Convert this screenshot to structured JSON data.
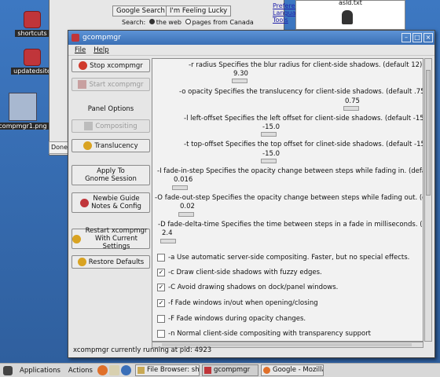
{
  "desktop": {
    "icons": [
      {
        "label": "shortcuts"
      },
      {
        "label": "updatedsite"
      },
      {
        "label": "compmgr1.png"
      }
    ]
  },
  "background_browser": {
    "search_button": "Google Search",
    "lucky_button": "I'm Feeling Lucky",
    "search_label": "Search:",
    "radio_web": "the web",
    "radio_canada": "pages from Canada",
    "link_preferences": "Preferences",
    "link_language": "Language Tools",
    "right_file": "asld.txt",
    "partial_button": "Done"
  },
  "window": {
    "title": "gcompmgr",
    "menu": {
      "file": "File",
      "help": "Help"
    },
    "sidebar": {
      "stop": "Stop xcompmgr",
      "start": "Start xcompmgr",
      "panel_options": "Panel Options",
      "compositing": "Compositing",
      "translucency": "Translucency",
      "apply_line1": "Apply To",
      "apply_line2": "Gnome Session",
      "newbie_line1": "Newbie Guide",
      "newbie_line2": "Notes & Config",
      "restart_line1": "Restart xcompmgr",
      "restart_line2": "With Current Settings",
      "restore": "Restore Defaults"
    },
    "options": [
      {
        "text": "-r radius Specifies the blur radius for client-side shadows. (default 12)",
        "value": "9.30"
      },
      {
        "text": "-o opacity Specifies the translucency for client-side shadows. (default .75)",
        "value": "0.75"
      },
      {
        "text": "-l left-offset Specifies the left offset for client-side shadows. (default -15)",
        "value": "-15.0"
      },
      {
        "text": "-t top-offset Specifies the top offset for clinet-side shadows. (default -15)",
        "value": "-15.0"
      },
      {
        "text": "-I fade-in-step Specifies the opacity change between steps while fading in. (default 0.028)",
        "value": "0.016"
      },
      {
        "text": "-O fade-out-step Specifies the opacity change between steps while fading out. (default 0.03)",
        "value": "0.02"
      },
      {
        "text": "-D fade-delta-time Specifies the time between steps in a fade in milliseconds. (default 10)",
        "value": "2.4"
      }
    ],
    "checkboxes": [
      {
        "text": "-a Use automatic server-side compositing. Faster, but no special effects.",
        "checked": false
      },
      {
        "text": "-c Draw client-side shadows with fuzzy edges.",
        "checked": true
      },
      {
        "text": "-C Avoid drawing shadows on dock/panel windows.",
        "checked": true
      },
      {
        "text": "-f Fade windows in/out when opening/closing",
        "checked": true
      },
      {
        "text": "-F Fade windows during opacity changes.",
        "checked": false
      },
      {
        "text": "-n Normal client-side compositing with transparency support",
        "checked": false
      }
    ],
    "status": "xcompmgr currently running at pid: 4923"
  },
  "taskbar": {
    "applications": "Applications",
    "actions": "Actions",
    "tasks": [
      "File Browser: sho",
      "gcompmgr",
      "Google - Mozilla F"
    ]
  }
}
